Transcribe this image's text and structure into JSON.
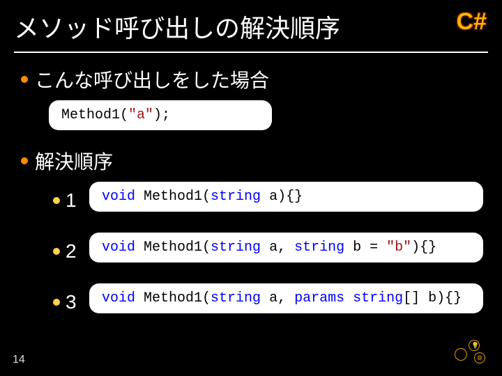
{
  "title": "メソッド呼び出しの解決順序",
  "logo": "C#",
  "section1": {
    "heading": "こんな呼び出しをした場合",
    "code": {
      "name": "Method1",
      "open": "(",
      "arg": "\"a\"",
      "close": ");"
    }
  },
  "section2": {
    "heading": "解決順序",
    "items": [
      {
        "num": "1",
        "sig": {
          "p1": "void",
          "name": " Method1(",
          "p2": "string",
          "tail": " a){}"
        }
      },
      {
        "num": "2",
        "sig": {
          "p1": "void",
          "name": " Method1(",
          "p2": "string",
          "mid": " a, ",
          "p3": "string",
          "mid2": " b = ",
          "lit": "\"b\"",
          "tail": "){}"
        }
      },
      {
        "num": "3",
        "sig": {
          "p1": "void",
          "name": " Method1(",
          "p2": "string",
          "mid": " a, ",
          "p3": "params",
          "sp": " ",
          "p4": "string",
          "tail": "[] b){}"
        }
      }
    ]
  },
  "page": "14"
}
